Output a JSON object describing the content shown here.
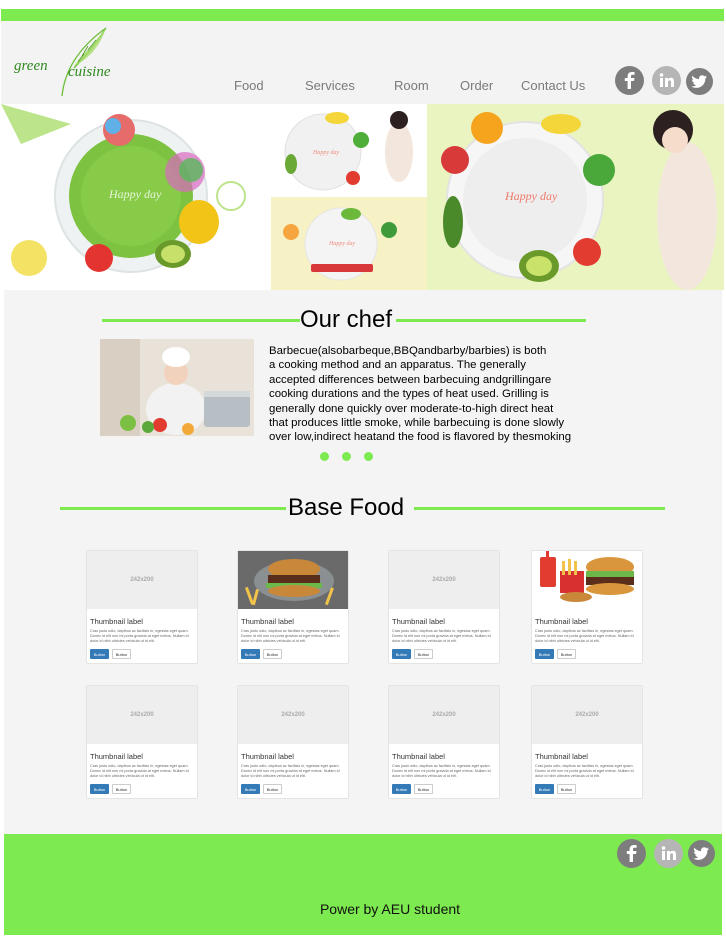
{
  "header": {
    "logo_word1": "green",
    "logo_word2": "cuisine",
    "nav": [
      "Food",
      "Services",
      "Room",
      "Order",
      "Contact Us"
    ],
    "social_icons": [
      "facebook-icon",
      "linkedin-icon",
      "twitter-icon"
    ]
  },
  "banner": {
    "texts": [
      "Happy day",
      "Happy day",
      "Happy day",
      "Happy day"
    ]
  },
  "chef": {
    "title": "Our chef",
    "lines": [
      "Barbecue(alsobarbeque,BBQandbarby/barbies) is both",
      "a cooking method and an apparatus. The generally",
      "accepted differences between barbecuing andgrillingare",
      "cooking durations and the types of heat used. Grilling is",
      " generally done quickly over moderate-to-high direct heat",
      " that produces little smoke, while barbecuing is done slowly",
      " over low,indirect heatand the food is flavored by thesmoking"
    ]
  },
  "base_food": {
    "title": "Base Food",
    "placeholder": "242x200",
    "label": "Thumbnail label",
    "description": "Cras justo odio, dapibus ac facilisis in, egestas eget quam. Donec id elit non mi porta gravida at eget metus. Nullam id dolor id nibh ultricies vehicula ut id elit.",
    "button_primary": "Button",
    "button_default": "Button"
  },
  "footer": {
    "text": "Power by AEU student"
  },
  "colors": {
    "accent": "#7dea4f",
    "primary_button": "#337ab7"
  }
}
